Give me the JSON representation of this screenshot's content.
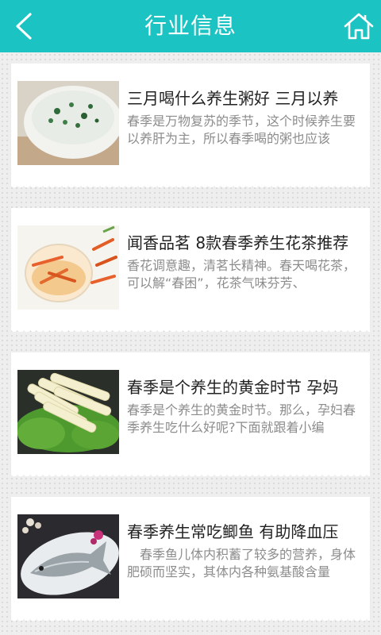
{
  "header": {
    "title": "行业信息",
    "back_icon": "chevron-left-icon",
    "home_icon": "home-icon",
    "bg_color": "#1cc3c3"
  },
  "articles": [
    {
      "title": "三月喝什么养生粥好 三月以养",
      "summary": "春季是万物复苏的季节，这个时候养生要以养肝为主，所以春季喝的粥也应该",
      "image": "green-vegetable-porridge-bowl"
    },
    {
      "title": "闻香品茗 8款春季养生花茶推荐",
      "summary": "香花调意趣，清茗长精神。春天喝花茶，可以解“春困”，花茶气味芬芳、",
      "image": "daylily-flower-tea-glass"
    },
    {
      "title": "春季是个养生的黄金时节 孕妈",
      "summary": "春季是个养生的黄金时节。那么，孕妇春季养生吃什么好呢?下面就跟着小编",
      "image": "bamboo-shoots-on-lettuce"
    },
    {
      "title": "春季养生常吃鲫鱼 有助降血压",
      "summary": "　春季鱼儿体内积蓄了较多的营养，身体肥硕而坚实，其体内各种氨基酸含量",
      "image": "crucian-carp-on-plate"
    }
  ]
}
